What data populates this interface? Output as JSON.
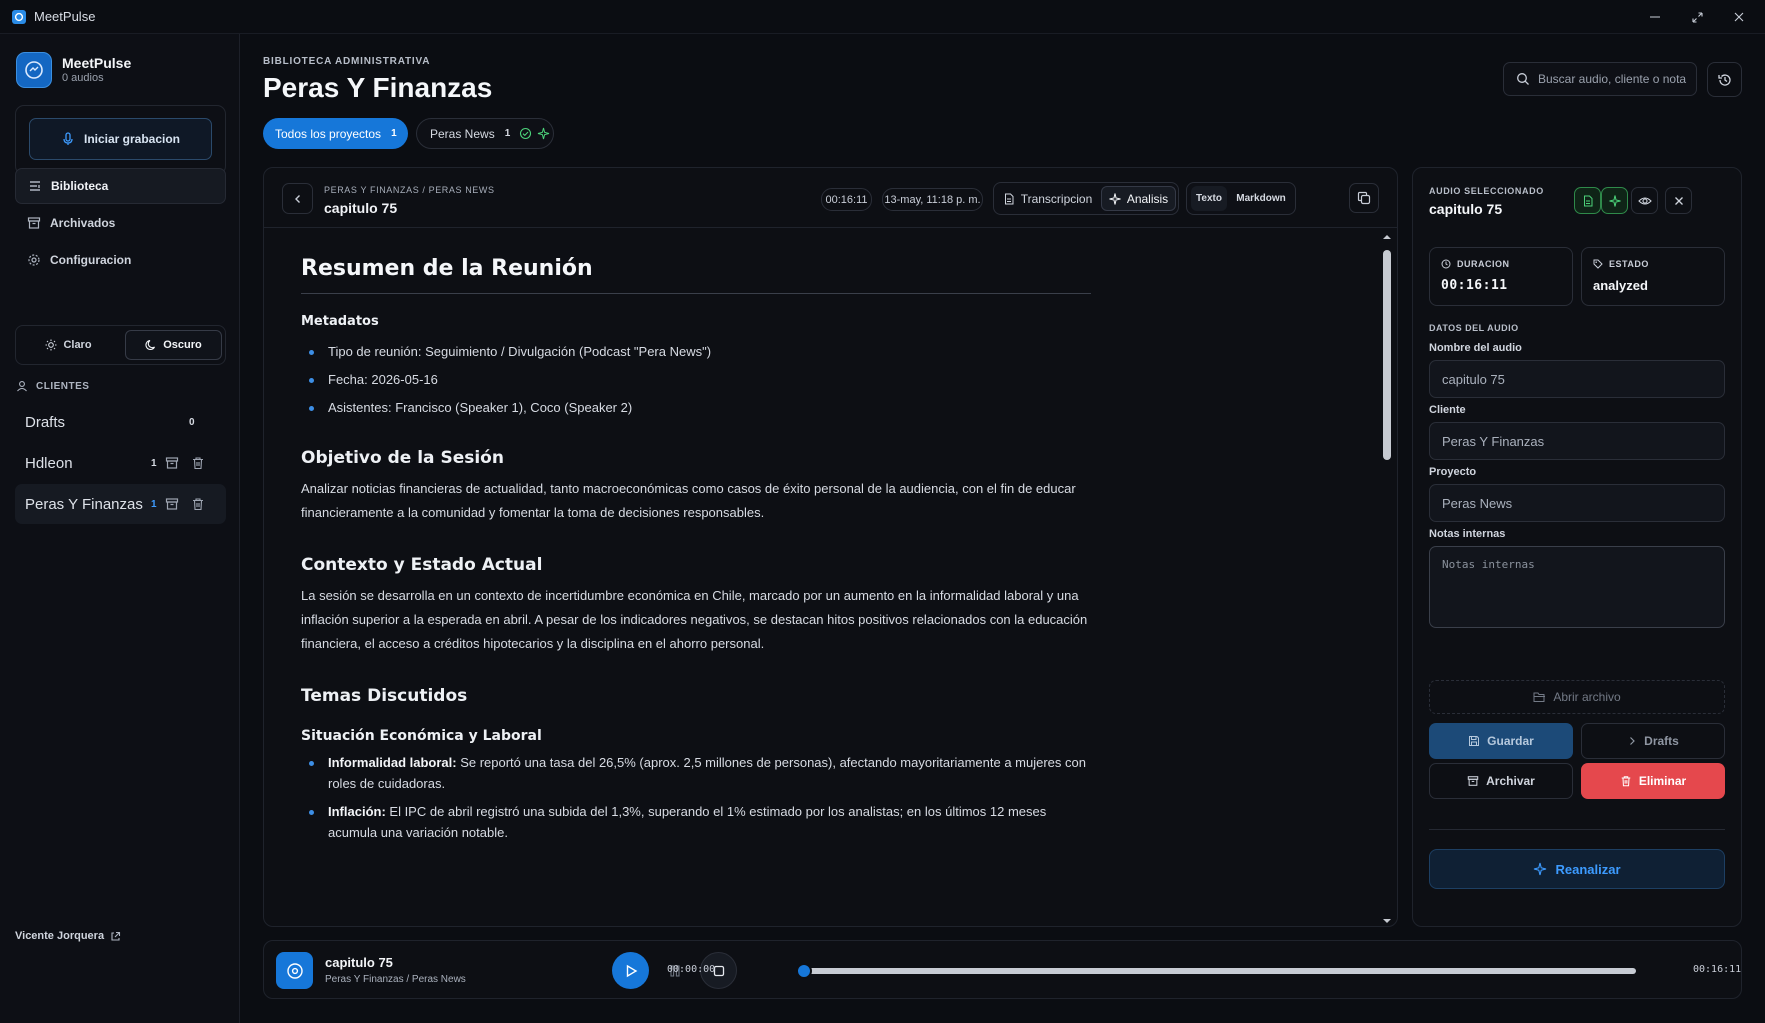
{
  "window": {
    "title": "MeetPulse"
  },
  "sidebar": {
    "brand_name": "MeetPulse",
    "brand_sub": "0 audios",
    "record_label": "Iniciar grabacion",
    "nav": [
      {
        "label": "Biblioteca",
        "icon": "library-icon",
        "active": true
      },
      {
        "label": "Archivados",
        "icon": "archive-icon",
        "active": false
      },
      {
        "label": "Configuracion",
        "icon": "gear-icon",
        "active": false
      }
    ],
    "theme": {
      "light_label": "Claro",
      "dark_label": "Oscuro",
      "selected": "Oscuro"
    },
    "clients_heading": "CLIENTES",
    "clients": [
      {
        "name": "Drafts",
        "count": "0"
      },
      {
        "name": "Hdleon",
        "count": "1"
      },
      {
        "name": "Peras Y Finanzas",
        "count": "1",
        "active": true
      }
    ],
    "user": "Vicente Jorquera"
  },
  "header": {
    "eyebrow": "BIBLIOTECA ADMINISTRATIVA",
    "title": "Peras Y Finanzas",
    "search_placeholder": "Buscar audio, cliente o nota",
    "chips": [
      {
        "label": "Todos los proyectos",
        "count": "1",
        "active": true
      },
      {
        "label": "Peras News",
        "count": "1",
        "active": false
      }
    ]
  },
  "document": {
    "breadcrumb": "PERAS Y FINANZAS / PERAS NEWS",
    "title": "capitulo 75",
    "duration": "00:16:11",
    "date": "13-may, 11:18 p. m.",
    "view_tabs": [
      "Transcripcion",
      "Analisis"
    ],
    "active_view": "Analisis",
    "format_tabs": [
      "Texto",
      "Markdown"
    ],
    "active_format": "Texto",
    "content": {
      "h1": "Resumen de la Reunión",
      "metadata_heading": "Metadatos",
      "metadata": [
        "Tipo de reunión: Seguimiento / Divulgación (Podcast \"Pera News\")",
        "Fecha: 2026-05-16",
        "Asistentes: Francisco (Speaker 1), Coco (Speaker 2)"
      ],
      "objective_heading": "Objetivo de la Sesión",
      "objective_text": "Analizar noticias financieras de actualidad, tanto macroeconómicas como casos de éxito personal de la audiencia, con el fin de educar financieramente a la comunidad y fomentar la toma de decisiones responsables.",
      "context_heading": "Contexto y Estado Actual",
      "context_text": "La sesión se desarrolla en un contexto de incertidumbre económica en Chile, marcado por un aumento en la informalidad laboral y una inflación superior a la esperada en abril. A pesar de los indicadores negativos, se destacan hitos positivos relacionados con la educación financiera, el acceso a créditos hipotecarios y la disciplina en el ahorro personal.",
      "topics_heading": "Temas Discutidos",
      "sub_heading": "Situación Económica y Laboral",
      "topic_items": [
        {
          "bold": "Informalidad laboral:",
          "text": " Se reportó una tasa del 26,5% (aprox. 2,5 millones de personas), afectando mayoritariamente a mujeres con roles de cuidadoras."
        },
        {
          "bold": "Inflación:",
          "text": " El IPC de abril registró una subida del 1,3%, superando el 1% estimado por los analistas; en los últimos 12 meses acumula una variación notable."
        }
      ]
    }
  },
  "details": {
    "eyebrow": "AUDIO SELECCIONADO",
    "title": "capitulo 75",
    "duration_label": "DURACION",
    "duration_value": "00:16:11",
    "status_label": "ESTADO",
    "status_value": "analyzed",
    "section_label": "DATOS DEL AUDIO",
    "name_label": "Nombre del audio",
    "name_value": "capitulo 75",
    "client_label": "Cliente",
    "client_value": "Peras Y Finanzas",
    "project_label": "Proyecto",
    "project_value": "Peras News",
    "notes_label": "Notas internas",
    "notes_placeholder": "Notas internas",
    "open_file": "Abrir archivo",
    "save": "Guardar",
    "drafts": "Drafts",
    "archive": "Archivar",
    "delete": "Eliminar",
    "reanalyze": "Reanalizar"
  },
  "player": {
    "title": "capitulo 75",
    "subtitle": "Peras Y Finanzas / Peras News",
    "current": "00:00:00",
    "total": "00:16:11",
    "progress": 0
  },
  "colors": {
    "accent": "#1677d9",
    "danger": "#e5484d",
    "success": "#4cd27a",
    "background": "#0b0d12"
  }
}
